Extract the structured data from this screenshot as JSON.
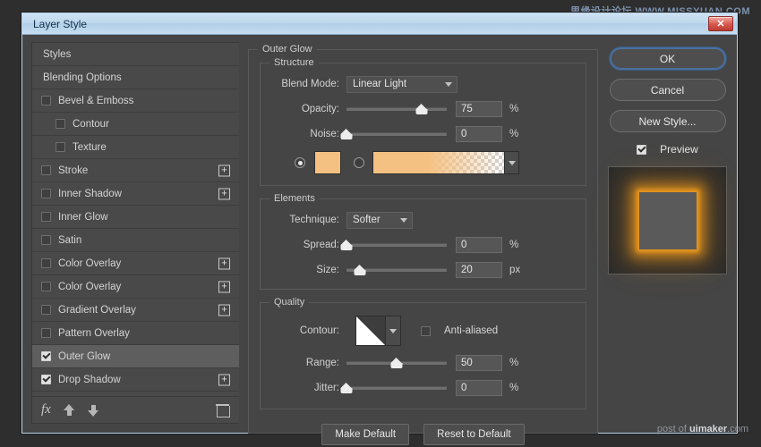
{
  "watermarks": {
    "top": "思缘设计论坛 WWW.MISSYUAN.COM",
    "bottom_prefix": "post of ",
    "bottom_brand": "uimaker",
    "bottom_suffix": ".com"
  },
  "window": {
    "title": "Layer Style",
    "close_label": "✕"
  },
  "styles_panel": {
    "items": [
      {
        "label": "Styles",
        "type": "header",
        "checked": null,
        "indent": false,
        "plus": false,
        "selected": false
      },
      {
        "label": "Blending Options",
        "type": "header",
        "checked": null,
        "indent": false,
        "plus": false,
        "selected": false
      },
      {
        "label": "Bevel & Emboss",
        "type": "effect",
        "checked": false,
        "indent": false,
        "plus": false,
        "selected": false
      },
      {
        "label": "Contour",
        "type": "effect",
        "checked": false,
        "indent": true,
        "plus": false,
        "selected": false
      },
      {
        "label": "Texture",
        "type": "effect",
        "checked": false,
        "indent": true,
        "plus": false,
        "selected": false
      },
      {
        "label": "Stroke",
        "type": "effect",
        "checked": false,
        "indent": false,
        "plus": true,
        "selected": false
      },
      {
        "label": "Inner Shadow",
        "type": "effect",
        "checked": false,
        "indent": false,
        "plus": true,
        "selected": false
      },
      {
        "label": "Inner Glow",
        "type": "effect",
        "checked": false,
        "indent": false,
        "plus": false,
        "selected": false
      },
      {
        "label": "Satin",
        "type": "effect",
        "checked": false,
        "indent": false,
        "plus": false,
        "selected": false
      },
      {
        "label": "Color Overlay",
        "type": "effect",
        "checked": false,
        "indent": false,
        "plus": true,
        "selected": false
      },
      {
        "label": "Color Overlay",
        "type": "effect",
        "checked": false,
        "indent": false,
        "plus": true,
        "selected": false
      },
      {
        "label": "Gradient Overlay",
        "type": "effect",
        "checked": false,
        "indent": false,
        "plus": true,
        "selected": false
      },
      {
        "label": "Pattern Overlay",
        "type": "effect",
        "checked": false,
        "indent": false,
        "plus": false,
        "selected": false
      },
      {
        "label": "Outer Glow",
        "type": "effect",
        "checked": true,
        "indent": false,
        "plus": false,
        "selected": true
      },
      {
        "label": "Drop Shadow",
        "type": "effect",
        "checked": true,
        "indent": false,
        "plus": true,
        "selected": false
      }
    ],
    "toolbar": {
      "fx_label": "fx",
      "move_up_icon": "arrow-up-icon",
      "move_down_icon": "arrow-down-icon",
      "delete_icon": "trash-icon"
    }
  },
  "main": {
    "group_title": "Outer Glow",
    "structure": {
      "legend": "Structure",
      "blend_mode_label": "Blend Mode:",
      "blend_mode_value": "Linear Light",
      "opacity_label": "Opacity:",
      "opacity_value": "75",
      "opacity_unit": "%",
      "opacity_pct": 75,
      "noise_label": "Noise:",
      "noise_value": "0",
      "noise_unit": "%",
      "noise_pct": 0,
      "fill_color_selected": true,
      "fill_color_hex": "#F5C183",
      "gradient_selected": false,
      "gradient_start_hex": "#F5C183"
    },
    "elements": {
      "legend": "Elements",
      "technique_label": "Technique:",
      "technique_value": "Softer",
      "spread_label": "Spread:",
      "spread_value": "0",
      "spread_unit": "%",
      "spread_pct": 0,
      "size_label": "Size:",
      "size_value": "20",
      "size_unit": "px",
      "size_pct": 13
    },
    "quality": {
      "legend": "Quality",
      "contour_label": "Contour:",
      "anti_aliased_label": "Anti-aliased",
      "anti_aliased_checked": false,
      "range_label": "Range:",
      "range_value": "50",
      "range_unit": "%",
      "range_pct": 50,
      "jitter_label": "Jitter:",
      "jitter_value": "0",
      "jitter_unit": "%",
      "jitter_pct": 0
    },
    "buttons": {
      "make_default": "Make Default",
      "reset_to_default": "Reset to Default"
    }
  },
  "sidebar_right": {
    "ok": "OK",
    "cancel": "Cancel",
    "new_style": "New Style...",
    "preview_label": "Preview",
    "preview_checked": true,
    "glow_color_hex": "#E8961E"
  }
}
